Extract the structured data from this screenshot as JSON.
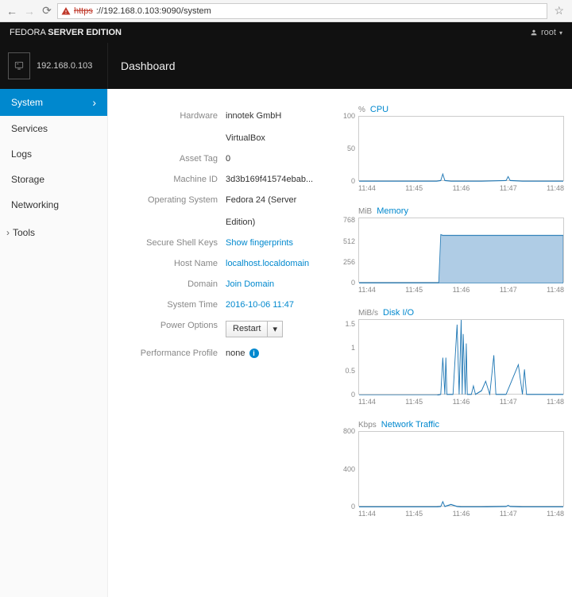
{
  "browser": {
    "url_scheme": "https",
    "url_rest": "://192.168.0.103:9090/system"
  },
  "brand": {
    "prefix": "FEDORA ",
    "bold": "SERVER EDITION"
  },
  "user_menu": "root",
  "host_ip": "192.168.0.103",
  "section_title": "Dashboard",
  "sidebar": {
    "items": [
      {
        "label": "System",
        "active": true
      },
      {
        "label": "Services"
      },
      {
        "label": "Logs"
      },
      {
        "label": "Storage"
      },
      {
        "label": "Networking"
      }
    ],
    "group": "Tools"
  },
  "info": {
    "hardware_label": "Hardware",
    "hardware_value_l1": "innotek GmbH",
    "hardware_value_l2": "VirtualBox",
    "asset_tag_label": "Asset Tag",
    "asset_tag_value": "0",
    "machine_id_label": "Machine ID",
    "machine_id_value": "3d3b169f41574ebab...",
    "os_label": "Operating System",
    "os_value_l1": "Fedora 24 (Server",
    "os_value_l2": "Edition)",
    "ssh_label": "Secure Shell Keys",
    "ssh_value": "Show fingerprints",
    "hostname_label": "Host Name",
    "hostname_value": "localhost.localdomain",
    "domain_label": "Domain",
    "domain_value": "Join Domain",
    "systime_label": "System Time",
    "systime_value": "2016-10-06 11:47",
    "power_label": "Power Options",
    "power_btn": "Restart",
    "perf_label": "Performance Profile",
    "perf_value": "none"
  },
  "chart_data": [
    {
      "type": "line",
      "unit": "%",
      "title": "CPU",
      "ylim": [
        0,
        100
      ],
      "yticks": [
        0,
        50,
        100
      ],
      "xticks": [
        "11:44",
        "11:45",
        "11:46",
        "11:47",
        "11:48"
      ],
      "x": [
        0,
        0.1,
        0.2,
        0.3,
        0.38,
        0.4,
        0.41,
        0.42,
        0.45,
        0.5,
        0.6,
        0.72,
        0.73,
        0.74,
        0.8,
        0.9,
        1.0
      ],
      "y": [
        1,
        1,
        1,
        1,
        1,
        2,
        12,
        2,
        1,
        1,
        1,
        2,
        8,
        2,
        1,
        1,
        1
      ]
    },
    {
      "type": "area",
      "unit": "MiB",
      "title": "Memory",
      "ylim": [
        0,
        800
      ],
      "yticks": [
        0,
        256,
        512,
        768
      ],
      "xticks": [
        "11:44",
        "11:45",
        "11:46",
        "11:47",
        "11:48"
      ],
      "x": [
        0,
        0.39,
        0.4,
        0.41,
        1.0
      ],
      "y": [
        8,
        8,
        600,
        590,
        590
      ]
    },
    {
      "type": "line",
      "unit": "MiB/s",
      "title": "Disk I/O",
      "ylim": [
        0,
        1.6
      ],
      "yticks": [
        0,
        0.5,
        1,
        1.5
      ],
      "xticks": [
        "11:44",
        "11:45",
        "11:46",
        "11:47",
        "11:48"
      ],
      "x": [
        0,
        0.38,
        0.4,
        0.41,
        0.42,
        0.425,
        0.43,
        0.44,
        0.46,
        0.48,
        0.49,
        0.5,
        0.505,
        0.51,
        0.52,
        0.525,
        0.53,
        0.535,
        0.55,
        0.56,
        0.57,
        0.6,
        0.62,
        0.64,
        0.66,
        0.67,
        0.68,
        0.7,
        0.72,
        0.78,
        0.8,
        0.81,
        0.82,
        0.9,
        1.0
      ],
      "y": [
        0,
        0,
        0.02,
        0.8,
        0.02,
        0.8,
        0.02,
        0.02,
        0.02,
        1.5,
        0.02,
        1.6,
        0.02,
        1.3,
        0.02,
        1.1,
        0.02,
        0.02,
        0.02,
        0.2,
        0.02,
        0.1,
        0.3,
        0.02,
        0.85,
        0.02,
        0.02,
        0.02,
        0.02,
        0.65,
        0.02,
        0.55,
        0.02,
        0.02,
        0.02
      ]
    },
    {
      "type": "line",
      "unit": "Kbps",
      "title": "Network Traffic",
      "ylim": [
        0,
        800
      ],
      "yticks": [
        0,
        400,
        800
      ],
      "xticks": [
        "11:44",
        "11:45",
        "11:46",
        "11:47",
        "11:48"
      ],
      "x": [
        0,
        0.1,
        0.2,
        0.3,
        0.38,
        0.4,
        0.41,
        0.42,
        0.45,
        0.48,
        0.5,
        0.6,
        0.72,
        0.73,
        0.74,
        0.8,
        0.9,
        1.0
      ],
      "y": [
        4,
        4,
        4,
        4,
        4,
        8,
        60,
        8,
        30,
        8,
        4,
        4,
        8,
        20,
        8,
        4,
        4,
        4
      ]
    }
  ]
}
